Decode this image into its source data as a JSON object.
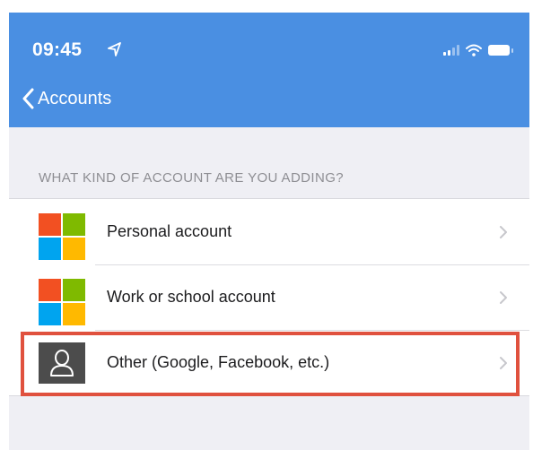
{
  "status_bar": {
    "time": "09:45"
  },
  "nav": {
    "back_label": "Accounts"
  },
  "section_header": "WHAT KIND OF ACCOUNT ARE YOU ADDING?",
  "accounts": [
    {
      "label": "Personal account",
      "icon": "microsoft-logo-icon"
    },
    {
      "label": "Work or school account",
      "icon": "microsoft-logo-icon"
    },
    {
      "label": "Other (Google, Facebook, etc.)",
      "icon": "person-icon",
      "highlighted": true
    }
  ],
  "colors": {
    "header": "#4a8fe2",
    "highlight_border": "#e0513e",
    "background": "#efeff4"
  }
}
